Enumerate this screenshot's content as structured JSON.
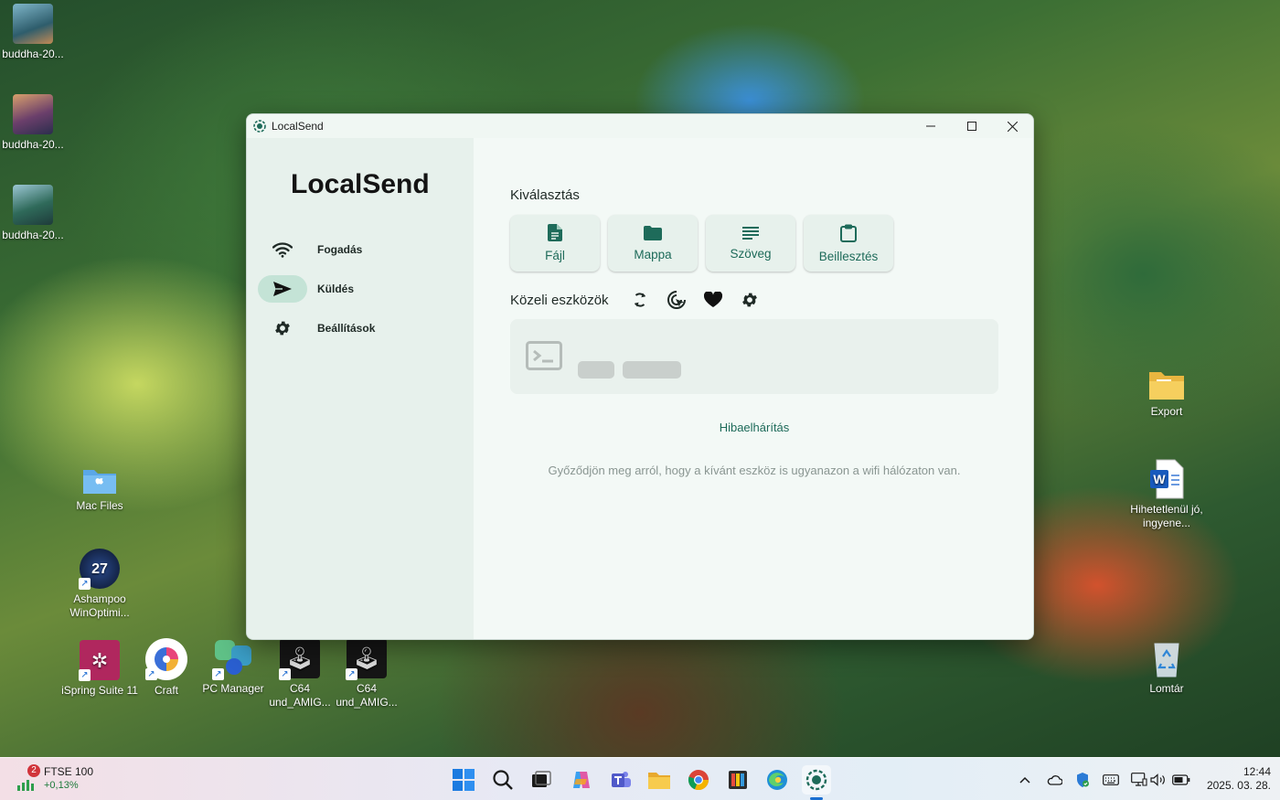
{
  "desktop": {
    "icons_left": [
      {
        "label": "buddha-20..."
      },
      {
        "label": "buddha-20..."
      },
      {
        "label": "buddha-20..."
      },
      {
        "label": "Mac Files"
      },
      {
        "label": "Ashampoo WinOptimi..."
      },
      {
        "label": "iSpring Suite 11"
      },
      {
        "label": "Craft"
      },
      {
        "label": "PC Manager"
      },
      {
        "label": "C64 und_AMIG..."
      },
      {
        "label": "C64 und_AMIG..."
      }
    ],
    "icons_right": [
      {
        "label": "Export"
      },
      {
        "label": "Hihetetlenül jó, ingyene..."
      },
      {
        "label": "Lomtár"
      }
    ],
    "ashampoo_badge": "27"
  },
  "window": {
    "title": "LocalSend",
    "sidebar": {
      "brand": "LocalSend",
      "items": [
        {
          "label": "Fogadás",
          "icon": "wifi-icon"
        },
        {
          "label": "Küldés",
          "icon": "send-icon",
          "active": true
        },
        {
          "label": "Beállítások",
          "icon": "gear-icon"
        }
      ]
    },
    "main": {
      "selection_title": "Kiválasztás",
      "tiles": [
        {
          "label": "Fájl",
          "icon": "file-icon"
        },
        {
          "label": "Mappa",
          "icon": "folder-icon"
        },
        {
          "label": "Szöveg",
          "icon": "text-icon"
        },
        {
          "label": "Beillesztés",
          "icon": "clipboard-icon"
        }
      ],
      "nearby_title": "Közeli eszközök",
      "troubleshoot_label": "Hibaelhárítás",
      "hint": "Győződjön meg arról, hogy a kívánt eszköz is ugyanazon a wifi hálózaton van."
    }
  },
  "taskbar": {
    "widget": {
      "badge": "2",
      "title": "FTSE 100",
      "change": "+0,13%"
    },
    "clock": {
      "time": "12:44",
      "date": "2025. 03. 28."
    }
  },
  "colors": {
    "accent": "#1e6b5a",
    "sidebar": "#e7f1ec",
    "content": "#f3f9f6"
  }
}
